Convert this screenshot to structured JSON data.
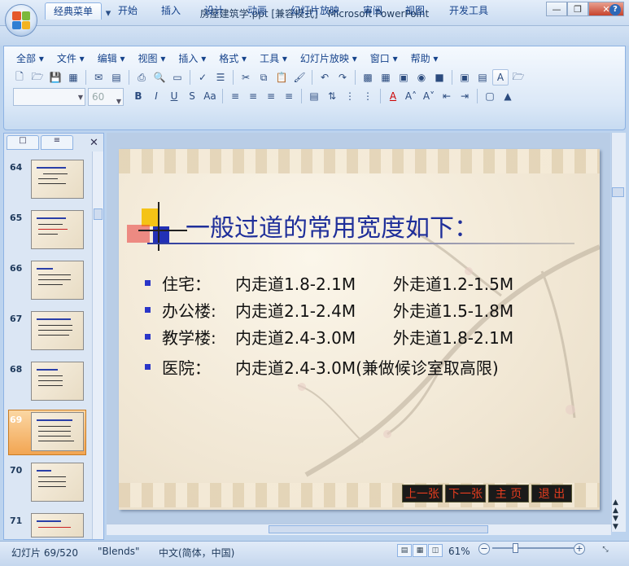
{
  "window": {
    "title": "房屋建筑学.ppt [兼容模式] - Microsoft PowerPoint",
    "controls": [
      "minimize-icon",
      "restore-icon",
      "close-icon"
    ]
  },
  "qat": {
    "icons": [
      "save-icon",
      "undo-icon",
      "redo-icon",
      "customize-icon"
    ]
  },
  "ribbon_tabs": [
    "经典菜单",
    "开始",
    "插入",
    "设计",
    "动画",
    "幻灯片放映",
    "审阅",
    "视图",
    "开发工具"
  ],
  "active_tab": "经典菜单",
  "menu": [
    "全部 ▾",
    "文件 ▾",
    "编辑 ▾",
    "视图 ▾",
    "插入 ▾",
    "格式 ▾",
    "工具 ▾",
    "幻灯片放映 ▾",
    "窗口 ▾",
    "帮助 ▾"
  ],
  "font_size": "60",
  "thumbnails": [
    {
      "num": "64"
    },
    {
      "num": "65"
    },
    {
      "num": "66"
    },
    {
      "num": "67"
    },
    {
      "num": "68"
    },
    {
      "num": "69"
    },
    {
      "num": "70"
    },
    {
      "num": "71"
    }
  ],
  "selected_slide": "69",
  "slide": {
    "title": "一般过道的常用宽度如下：",
    "bullets": [
      {
        "label": "住宅：",
        "inner": "内走道1.8-2.1M",
        "outer": "外走道1.2-1.5M"
      },
      {
        "label": "办公楼:",
        "inner": "内走道2.1-2.4M",
        "outer": "外走道1.5-1.8M"
      },
      {
        "label": "教学楼:",
        "inner": "内走道2.4-3.0M",
        "outer": "外走道1.8-2.1M"
      },
      {
        "label": "医院：",
        "inner": "内走道2.4-3.0M(兼做候诊室取高限)",
        "outer": ""
      }
    ],
    "nav": [
      "上一张",
      "下一张",
      "主 页",
      "退 出"
    ]
  },
  "status": {
    "slide_info": "幻灯片 69/520",
    "theme": "\"Blends\"",
    "language": "中文(简体，中国)",
    "zoom": "61%"
  },
  "colors": {
    "title_blue": "#1f2f9a",
    "bullet_blue": "#2a35c8",
    "nav_red": "#e63d1f"
  }
}
